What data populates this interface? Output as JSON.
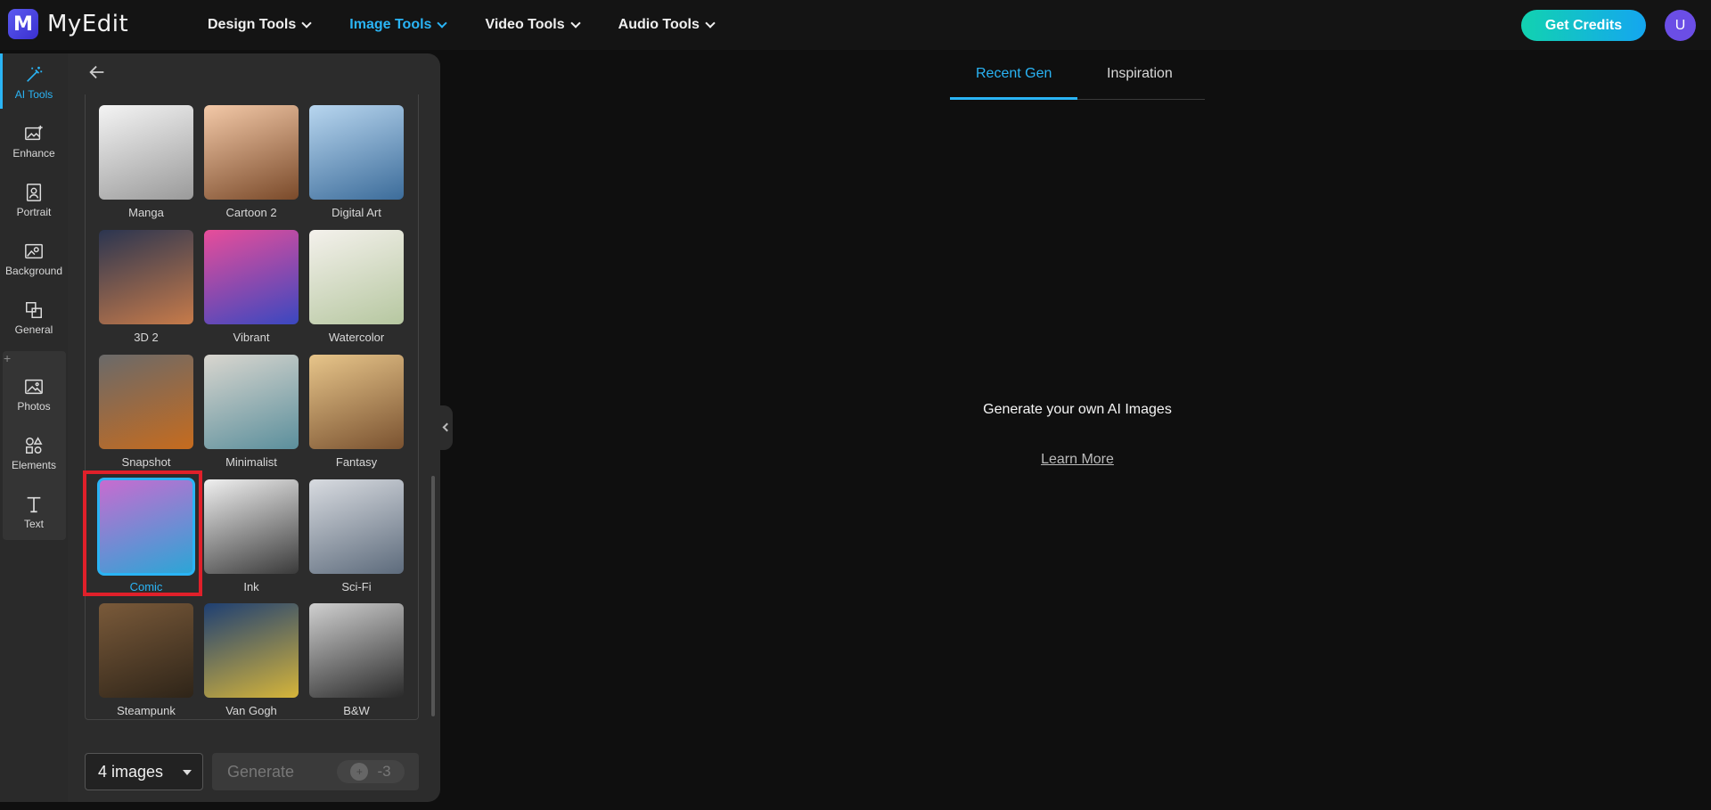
{
  "app": {
    "name": "MyEdit",
    "logo_letter": "M"
  },
  "nav": [
    {
      "label": "Design Tools",
      "active": false
    },
    {
      "label": "Image Tools",
      "active": true
    },
    {
      "label": "Video Tools",
      "active": false
    },
    {
      "label": "Audio Tools",
      "active": false
    }
  ],
  "header": {
    "credits_label": "Get Credits",
    "avatar_initial": "U"
  },
  "rail": {
    "items": [
      {
        "label": "AI Tools",
        "icon": "magic-wand-icon",
        "active": true
      },
      {
        "label": "Enhance",
        "icon": "image-enhance-icon"
      },
      {
        "label": "Portrait",
        "icon": "portrait-icon"
      },
      {
        "label": "Background",
        "icon": "background-icon"
      },
      {
        "label": "General",
        "icon": "layers-icon"
      },
      {
        "label": "Photos",
        "icon": "photo-icon"
      },
      {
        "label": "Elements",
        "icon": "shapes-icon"
      },
      {
        "label": "Text",
        "icon": "text-icon"
      }
    ]
  },
  "styles": [
    {
      "label": "Manga",
      "bg": "linear-gradient(160deg,#f4f4f4,#9a9a9a)"
    },
    {
      "label": "Cartoon 2",
      "bg": "linear-gradient(160deg,#f3c9a8,#7a4a2a)"
    },
    {
      "label": "Digital Art",
      "bg": "linear-gradient(160deg,#b8d6ef,#3c6c9a)"
    },
    {
      "label": "3D 2",
      "bg": "linear-gradient(160deg,#2b3550,#c77b4a)"
    },
    {
      "label": "Vibrant",
      "bg": "linear-gradient(160deg,#e84d9a,#3a48c0)"
    },
    {
      "label": "Watercolor",
      "bg": "linear-gradient(160deg,#f4f1ec,#b6c7a0)"
    },
    {
      "label": "Snapshot",
      "bg": "linear-gradient(160deg,#6a6a6a,#c66b1e)"
    },
    {
      "label": "Minimalist",
      "bg": "linear-gradient(160deg,#d9d6cf,#5b8f9c)"
    },
    {
      "label": "Fantasy",
      "bg": "linear-gradient(160deg,#e7c58a,#7a5230)"
    },
    {
      "label": "Comic",
      "bg": "linear-gradient(160deg,#c96bd0,#2aa6d6)",
      "selected": true
    },
    {
      "label": "Ink",
      "bg": "linear-gradient(160deg,#f0f0f0,#3a3a3a)"
    },
    {
      "label": "Sci-Fi",
      "bg": "linear-gradient(160deg,#d8dbe0,#5d6b7c)"
    },
    {
      "label": "Steampunk",
      "bg": "linear-gradient(160deg,#7a5a3a,#2e2418)"
    },
    {
      "label": "Van Gogh",
      "bg": "linear-gradient(160deg,#1e3f73,#d6b53a)"
    },
    {
      "label": "B&W",
      "bg": "linear-gradient(160deg,#d0d0d0,#2a2a2a)"
    }
  ],
  "controls": {
    "count_value": "4 images",
    "generate_label": "Generate",
    "generate_cost": "-3"
  },
  "main": {
    "tabs": [
      {
        "label": "Recent Gen",
        "active": true
      },
      {
        "label": "Inspiration",
        "active": false
      }
    ],
    "empty_text": "Generate your own AI Images",
    "learn_more": "Learn More"
  },
  "colors": {
    "accent": "#2ab4f5",
    "highlight": "#e0202a"
  }
}
